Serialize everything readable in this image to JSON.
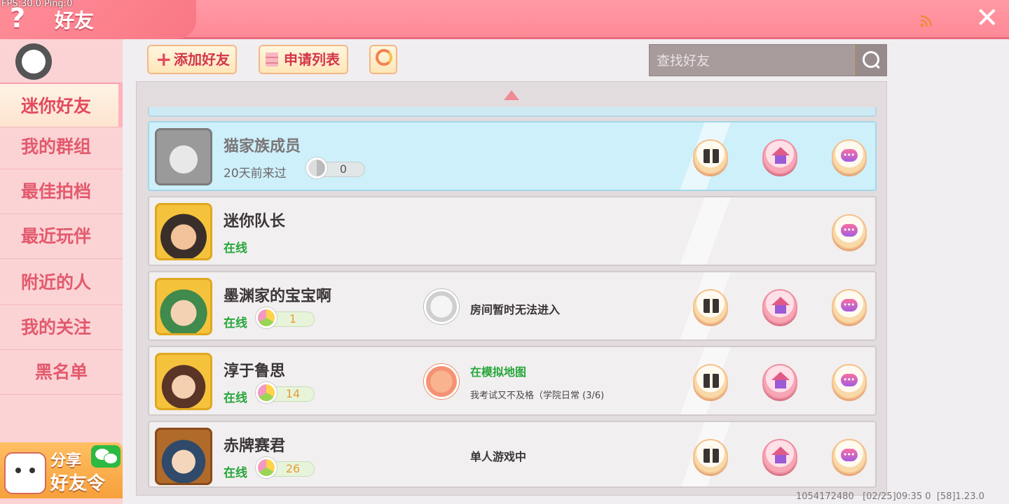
{
  "debug_overlay": "FPS:30.0  Ping:0",
  "header": {
    "help_icon": "?",
    "title": "好友",
    "close_icon": "✕"
  },
  "sidebar": {
    "items": [
      {
        "label": "迷你好友",
        "active": true
      },
      {
        "label": "我的群组"
      },
      {
        "label": "最佳拍档"
      },
      {
        "label": "最近玩伴"
      },
      {
        "label": "附近的人"
      },
      {
        "label": "我的关注"
      },
      {
        "label": "黑名单"
      }
    ],
    "share_banner": {
      "line1": "分享",
      "line2": "好友令"
    }
  },
  "toolbar": {
    "add_friend_label": "添加好友",
    "request_list_label": "申请列表",
    "search_placeholder": "查找好友"
  },
  "friends": [
    {
      "name": "猫家族成员",
      "status": "20天前来过",
      "level": "0",
      "room": "",
      "room_sub": "",
      "selected": true
    },
    {
      "name": "迷你队长",
      "status": "在线",
      "level": "",
      "room": "",
      "room_sub": ""
    },
    {
      "name": "墨渊家的宝宝啊",
      "status": "在线",
      "level": "1",
      "room": "房间暂时无法进入",
      "room_sub": ""
    },
    {
      "name": "淳于鲁思",
      "status": "在线",
      "level": "14",
      "room": "在模拟地图",
      "room_sub": "我考试又不及格（学院日常 (3/6)"
    },
    {
      "name": "赤牌赛君",
      "status": "在线",
      "level": "26",
      "room": "单人游戏中",
      "room_sub": ""
    }
  ],
  "footer": "1054172480   [02/25]09:35 0  [58]1.23.0",
  "colors": {
    "accent": "#ff8d98",
    "online": "#27a63c",
    "selected_row": "#cdf0fb"
  }
}
